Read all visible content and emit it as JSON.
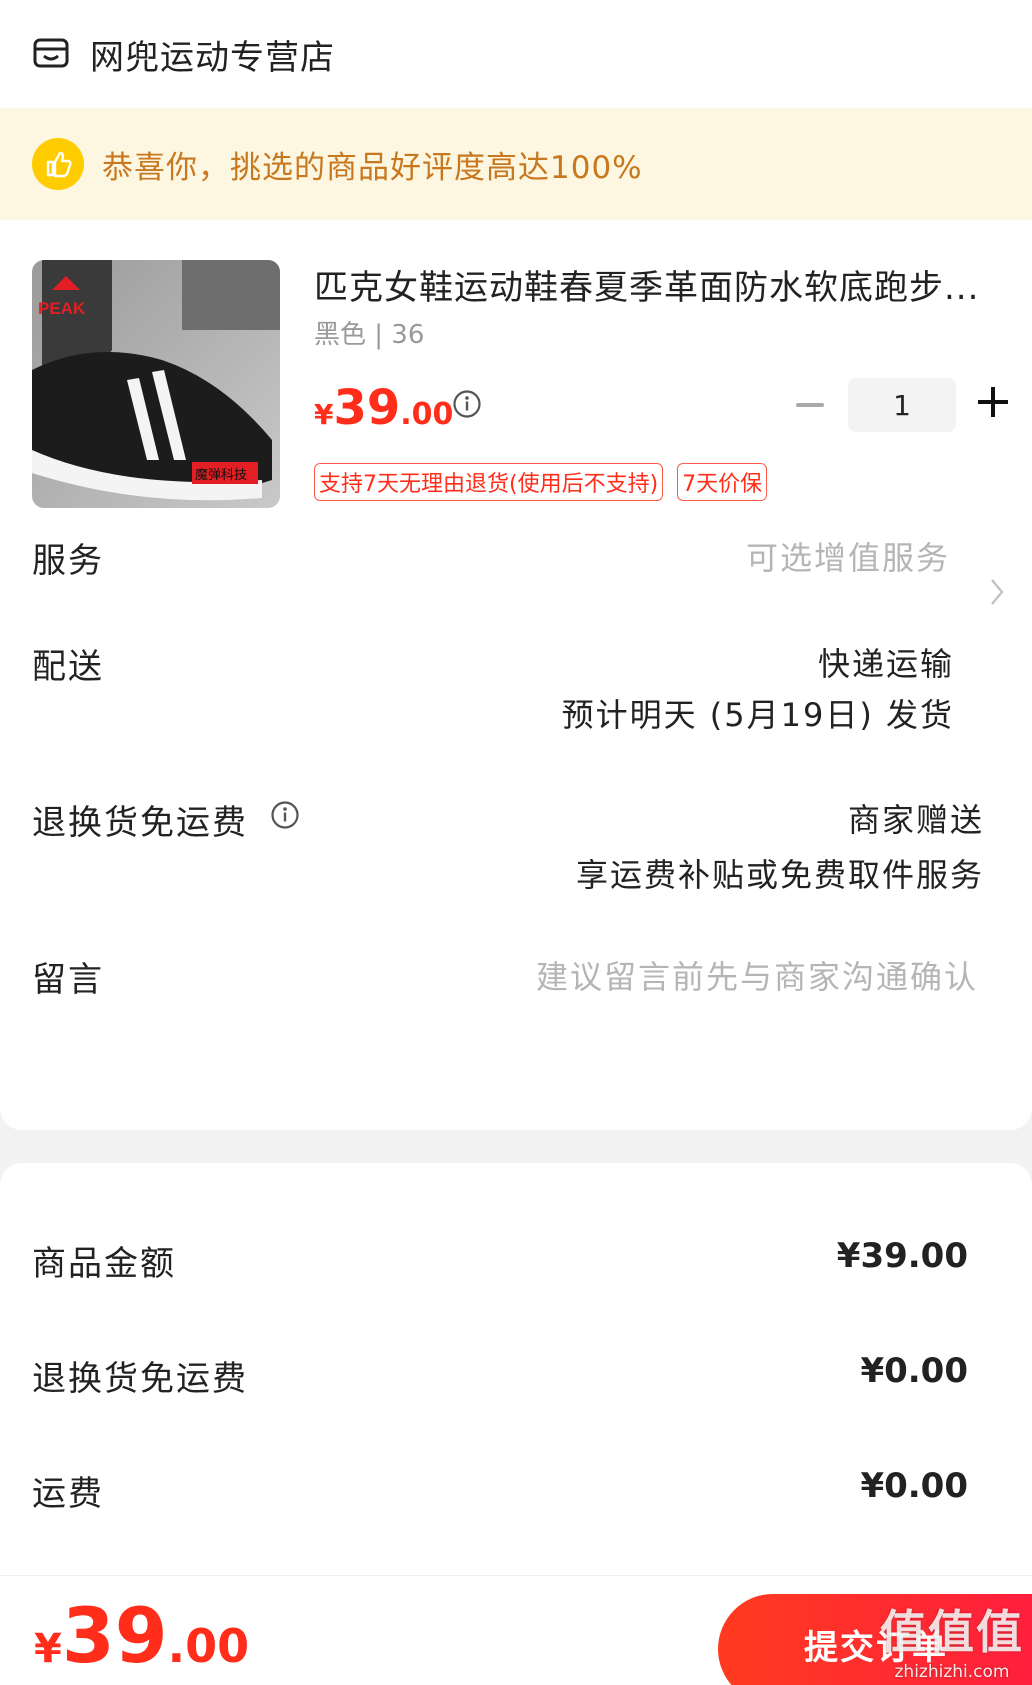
{
  "store": {
    "name": "网兜运动专营店",
    "icon": "store-icon"
  },
  "banner": {
    "text": "恭喜你，挑选的商品好评度高达100%",
    "icon": "thumbs-up-icon"
  },
  "product": {
    "title": "匹克女鞋运动鞋春夏季革面防水软底跑步...",
    "spec": "黑色 | 36",
    "price_symbol": "¥",
    "price_int": "39",
    "price_dec": ".00",
    "quantity": "1",
    "tags": [
      "支持7天无理由退货(使用后不支持)",
      "7天价保"
    ],
    "image_brand": "PEAK",
    "image_badge": "魔弹科技"
  },
  "rows": {
    "service": {
      "label": "服务",
      "value": "可选增值服务"
    },
    "delivery": {
      "label": "配送",
      "value1": "快递运输",
      "value2": "预计明天 (5月19日) 发货"
    },
    "return_shipping": {
      "label": "退换货免运费",
      "value1": "商家赠送",
      "value2": "享运费补贴或免费取件服务"
    },
    "message": {
      "label": "留言",
      "placeholder": "建议留言前先与商家沟通确认"
    }
  },
  "summary": {
    "goods_amount": {
      "label": "商品金额",
      "value": "¥39.00"
    },
    "return_fee": {
      "label": "退换货免运费",
      "value": "¥0.00"
    },
    "shipping": {
      "label": "运费",
      "value": "¥0.00"
    }
  },
  "footer": {
    "total_symbol": "¥",
    "total_int": "39",
    "total_dec": ".00",
    "submit_label": "提交订单",
    "watermark_big": "值值值",
    "watermark_small": "zhizhizhi.com"
  },
  "colors": {
    "accent": "#ff2d1a",
    "banner_bg": "#fdf6e0",
    "banner_text": "#c8781e"
  }
}
